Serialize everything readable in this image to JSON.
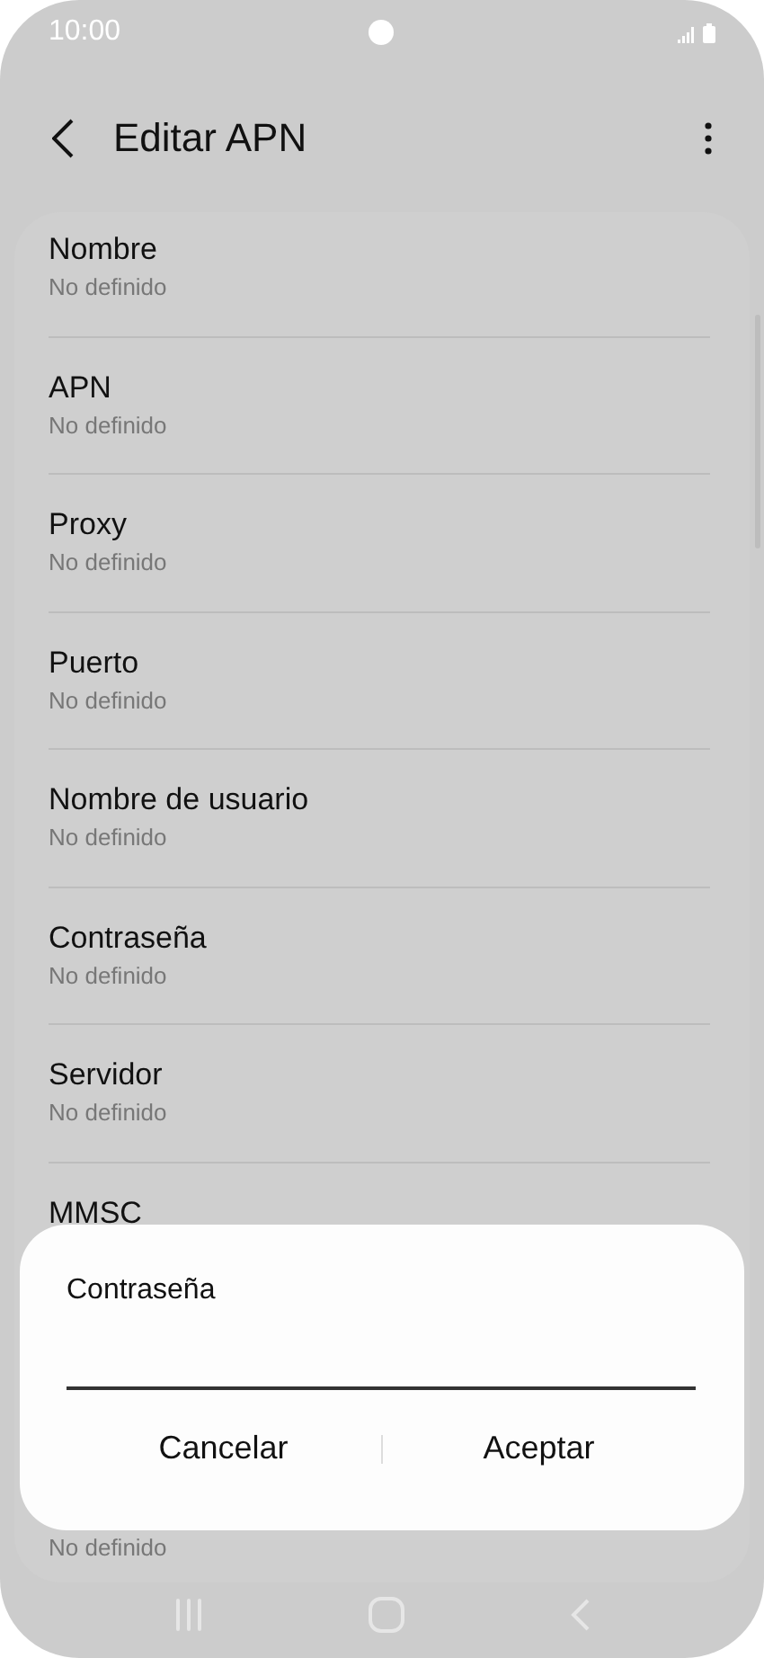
{
  "status_bar": {
    "time": "10:00"
  },
  "header": {
    "title": "Editar APN"
  },
  "items": [
    {
      "title": "Nombre",
      "value": "No definido"
    },
    {
      "title": "APN",
      "value": "No definido"
    },
    {
      "title": "Proxy",
      "value": "No definido"
    },
    {
      "title": "Puerto",
      "value": "No definido"
    },
    {
      "title": "Nombre de usuario",
      "value": "No definido"
    },
    {
      "title": "Contraseña",
      "value": "No definido"
    },
    {
      "title": "Servidor",
      "value": "No definido"
    },
    {
      "title": "MMSC"
    },
    {
      "value": "No definido"
    }
  ],
  "dialog": {
    "title": "Contraseña",
    "buttons": [
      "Cancelar",
      "Aceptar"
    ]
  }
}
